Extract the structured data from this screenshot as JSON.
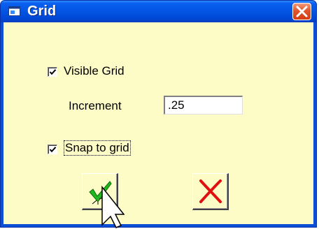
{
  "window": {
    "title": "Grid",
    "title_icon": "window-icon",
    "close_icon": "close-icon"
  },
  "options": {
    "visible_grid": {
      "label": "Visible Grid",
      "checked": true
    },
    "increment": {
      "label": "Increment",
      "value": ".25"
    },
    "snap_to_grid": {
      "label": "Snap to grid",
      "checked": true
    }
  },
  "buttons": {
    "ok": {
      "icon": "green-checkmark-icon"
    },
    "cancel": {
      "icon": "red-x-icon"
    }
  },
  "colors": {
    "client_bg": "#fdfbc6",
    "titlebar": "#0456e4",
    "close": "#d33c13",
    "ok_check": "#1fb81f",
    "cancel_x": "#e01010"
  }
}
